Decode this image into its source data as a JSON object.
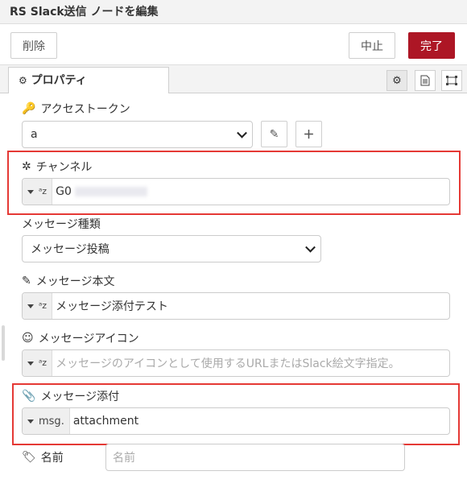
{
  "title": "RS Slack送信 ノードを編集",
  "buttons": {
    "delete": "削除",
    "cancel": "中止",
    "done": "完了"
  },
  "tab": {
    "label": "プロパティ"
  },
  "fields": {
    "access_token": {
      "label": "アクセストークン",
      "value": "a"
    },
    "channel": {
      "label": "チャンネル",
      "value": "G0"
    },
    "message_type": {
      "label": "メッセージ種類",
      "value": "メッセージ投稿"
    },
    "message_body": {
      "label": "メッセージ本文",
      "value": "メッセージ添付テスト"
    },
    "message_icon": {
      "label": "メッセージアイコン",
      "placeholder": "メッセージのアイコンとして使用するURLまたはSlack絵文字指定。"
    },
    "attachment": {
      "label": "メッセージ添付",
      "type_label": "msg.",
      "value": "attachment"
    },
    "name": {
      "label": "名前",
      "placeholder": "名前"
    }
  },
  "icons": {
    "edit_button": "pencil-icon",
    "add_button": "plus-icon",
    "settings_tab": "gear-icon",
    "description_tab": "document-icon",
    "appearance_tab": "frame-icon"
  },
  "colors": {
    "accent": "#ad1625",
    "highlight": "#e53935"
  }
}
